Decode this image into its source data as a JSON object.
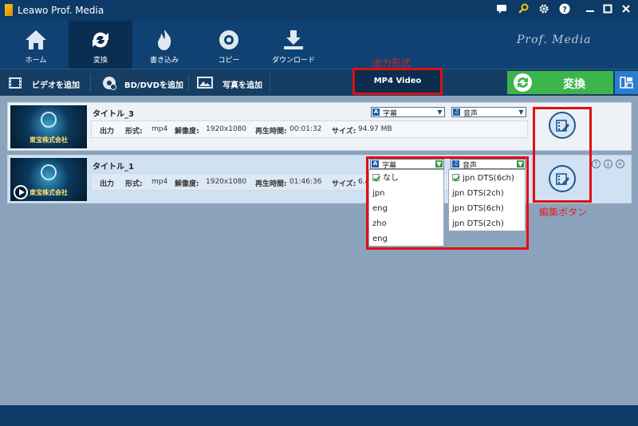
{
  "app": {
    "title": "Leawo Prof. Media",
    "brand": "Prof. Media"
  },
  "nav": [
    {
      "label": "ホーム",
      "icon": "home-icon"
    },
    {
      "label": "変換",
      "icon": "convert-icon",
      "active": true
    },
    {
      "label": "書き込み",
      "icon": "burn-icon"
    },
    {
      "label": "コピー",
      "icon": "disc-copy-icon"
    },
    {
      "label": "ダウンロード",
      "icon": "download-icon"
    }
  ],
  "toolbar": {
    "add_video": "ビデオを追加",
    "add_bd_dvd": "BD/DVDを追加",
    "add_photo": "写真を追加",
    "output_format": "MP4 Video",
    "convert": "変換"
  },
  "annotations": {
    "format_label": "出力形式",
    "edit_label": "編集ボタン",
    "color": "#e01010"
  },
  "files": [
    {
      "title": "タイトル_3",
      "thumb_caption": "東宝株式会社",
      "output_label": "出力",
      "format_key": "形式:",
      "format": "mp4",
      "res_key": "解像度:",
      "resolution": "1920x1080",
      "duration_key": "再生時間:",
      "duration": "00:01:32",
      "size_key": "サイズ:",
      "size": "94.97 MB",
      "subtitle_label": "字幕",
      "audio_label": "音声"
    },
    {
      "title": "タイトル_1",
      "thumb_caption": "東宝株式会社",
      "output_label": "出力",
      "format_key": "形式:",
      "format": "mp4",
      "res_key": "解像度:",
      "resolution": "1920x1080",
      "duration_key": "再生時間:",
      "duration": "01:46:36",
      "size_key": "サイズ:",
      "size": "6.4",
      "subtitle_label": "字幕",
      "audio_label": "音声"
    }
  ],
  "subtitle_options": [
    "なし",
    "jpn",
    "eng",
    "zho",
    "eng"
  ],
  "audio_options": [
    "jpn DTS(6ch)",
    "jpn DTS(2ch)",
    "jpn DTS(6ch)",
    "jpn DTS(2ch)"
  ],
  "colors": {
    "titlebar": "#0d3a66",
    "convert_green": "#3cb54a",
    "background": "#8ba3bc"
  }
}
